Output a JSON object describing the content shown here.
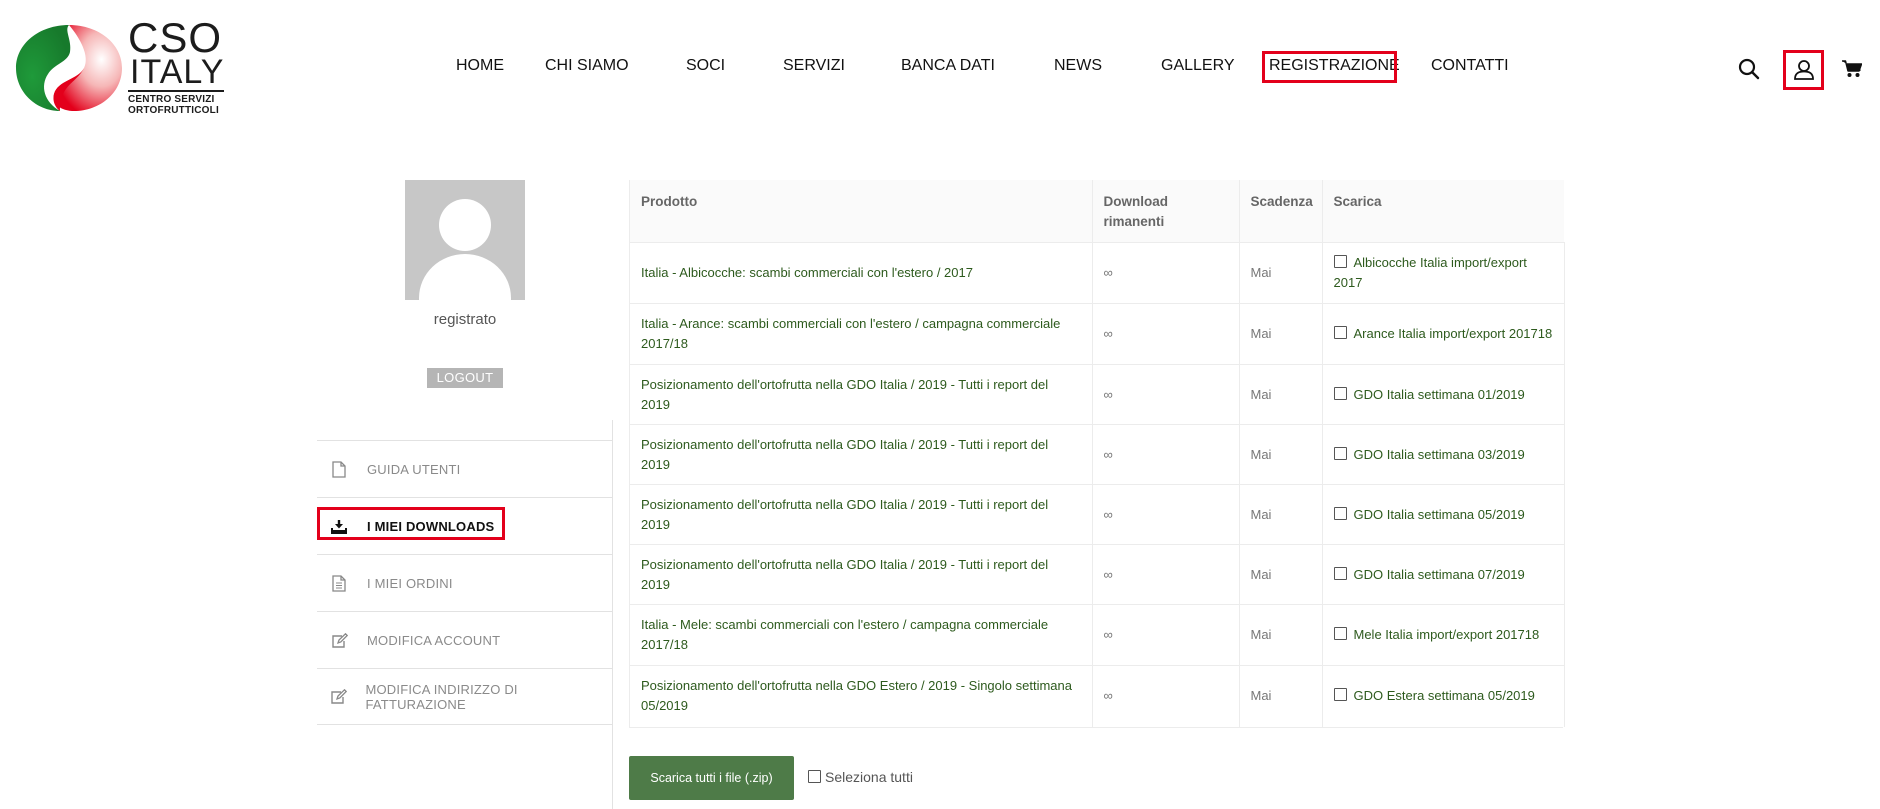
{
  "logo": {
    "line1": "CSO",
    "line2": "ITALY",
    "line3": "CENTRO SERVIZI",
    "line4": "ORTOFRUTTICOLI",
    "colors": {
      "green": "#1f9a3a",
      "red": "#e3001b"
    }
  },
  "nav": {
    "items": [
      {
        "label": "HOME"
      },
      {
        "label": "CHI SIAMO"
      },
      {
        "label": "SOCI"
      },
      {
        "label": "SERVIZI"
      },
      {
        "label": "BANCA DATI"
      },
      {
        "label": "NEWS"
      },
      {
        "label": "GALLERY"
      },
      {
        "label": "REGISTRAZIONE"
      },
      {
        "label": "CONTATTI"
      }
    ],
    "icons": [
      "search-icon",
      "user-icon",
      "cart-icon"
    ]
  },
  "profile": {
    "username": "registrato",
    "logout_label": "LOGOUT"
  },
  "menu": {
    "items": [
      {
        "label": "GUIDA UTENTI",
        "icon": "document-icon"
      },
      {
        "label": "I MIEI DOWNLOADS",
        "icon": "download-icon",
        "active": true
      },
      {
        "label": "I MIEI ORDINI",
        "icon": "orders-icon"
      },
      {
        "label": "MODIFICA ACCOUNT",
        "icon": "edit-icon"
      },
      {
        "label": "MODIFICA INDIRIZZO DI FATTURAZIONE",
        "icon": "edit-icon"
      }
    ]
  },
  "table": {
    "headers": [
      "Prodotto",
      "Download rimanenti",
      "Scadenza",
      "Scarica"
    ],
    "rows": [
      {
        "product": "Italia - Albicocche: scambi commerciali con l'estero / 2017",
        "remaining": "∞",
        "expiry": "Mai",
        "download": "Albicocche Italia import/export 2017"
      },
      {
        "product": "Italia - Arance: scambi commerciali con l'estero / campagna commerciale 2017/18",
        "remaining": "∞",
        "expiry": "Mai",
        "download": "Arance Italia import/export 201718"
      },
      {
        "product": "Posizionamento dell'ortofrutta nella GDO Italia / 2019 - Tutti i report del 2019",
        "remaining": "∞",
        "expiry": "Mai",
        "download": "GDO Italia settimana 01/2019"
      },
      {
        "product": "Posizionamento dell'ortofrutta nella GDO Italia / 2019 - Tutti i report del 2019",
        "remaining": "∞",
        "expiry": "Mai",
        "download": "GDO Italia settimana 03/2019"
      },
      {
        "product": "Posizionamento dell'ortofrutta nella GDO Italia / 2019 - Tutti i report del 2019",
        "remaining": "∞",
        "expiry": "Mai",
        "download": "GDO Italia settimana 05/2019"
      },
      {
        "product": "Posizionamento dell'ortofrutta nella GDO Italia / 2019 - Tutti i report del 2019",
        "remaining": "∞",
        "expiry": "Mai",
        "download": "GDO Italia settimana 07/2019"
      },
      {
        "product": "Italia - Mele: scambi commerciali con l'estero / campagna commerciale 2017/18",
        "remaining": "∞",
        "expiry": "Mai",
        "download": "Mele Italia import/export 201718"
      },
      {
        "product": "Posizionamento dell'ortofrutta nella GDO Estero / 2019 - Singolo settimana 05/2019",
        "remaining": "∞",
        "expiry": "Mai",
        "download": "GDO Estera settimana 05/2019"
      }
    ]
  },
  "actions": {
    "zip_label": "Scarica tutti i file (.zip)",
    "select_all_label": "Seleziona tutti"
  }
}
